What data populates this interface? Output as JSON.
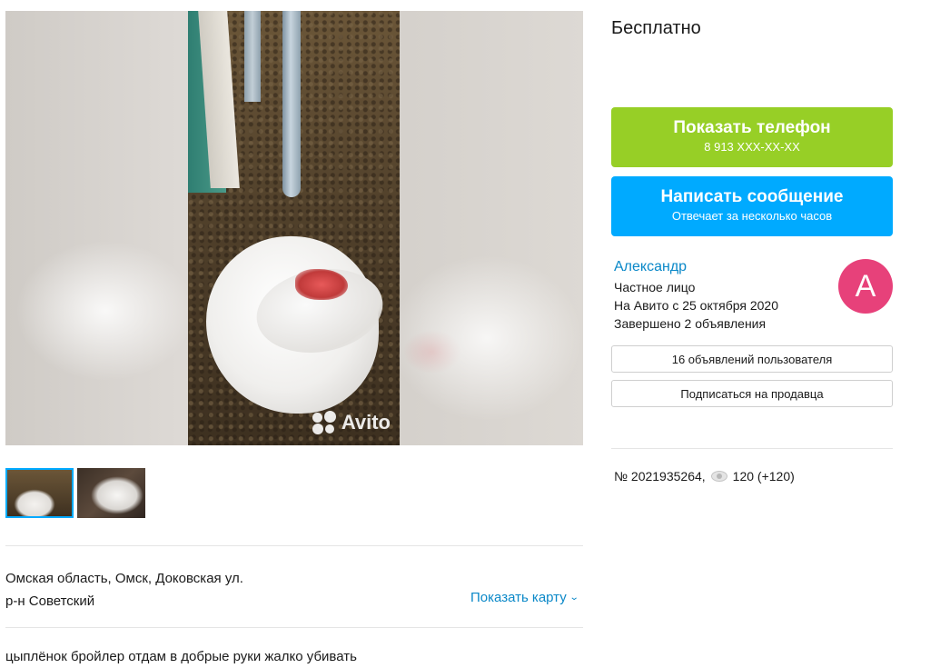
{
  "gallery": {
    "watermark": "Avito",
    "thumbnails": [
      {
        "alt": "photo-1",
        "active": true
      },
      {
        "alt": "photo-2",
        "active": false
      }
    ]
  },
  "location": {
    "address": "Омская область, Омск, Доковская ул.",
    "district": "р-н Советский",
    "map_link": "Показать карту"
  },
  "description": "цыплёнок бройлер отдам в добрые руки жалко убивать",
  "price": "Бесплатно",
  "buttons": {
    "phone_title": "Показать телефон",
    "phone_number": "8 913 XXX-XX-XX",
    "message_title": "Написать сообщение",
    "message_sub": "Отвечает за несколько часов"
  },
  "seller": {
    "name": "Александр",
    "type": "Частное лицо",
    "since": "На Авито с 25 октября 2020",
    "completed": "Завершено 2 объявления",
    "avatar_letter": "А",
    "avatar_color": "#e7417a",
    "ads_button": "16 объявлений пользователя",
    "subscribe_button": "Подписаться на продавца"
  },
  "listing": {
    "number": "№ 2021935264,",
    "views": "120 (+120)"
  },
  "colors": {
    "phone_button": "#97cf26",
    "message_button": "#00aaff",
    "link": "#0a88c8"
  }
}
